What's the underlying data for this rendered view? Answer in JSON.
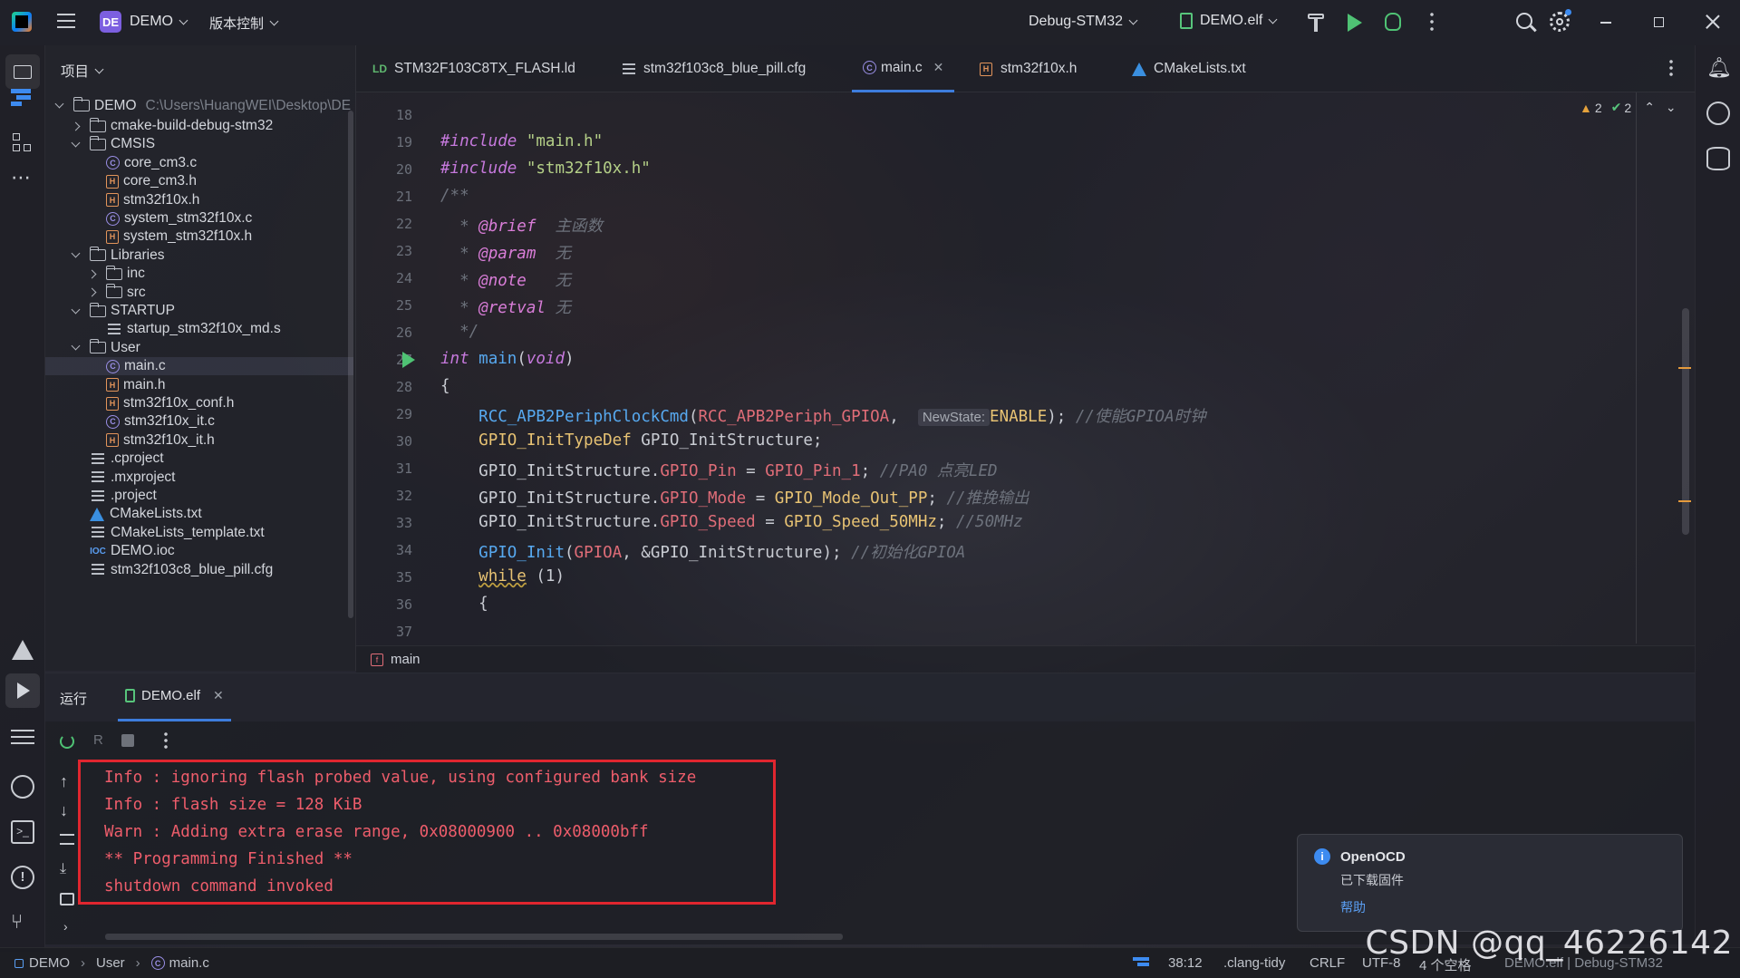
{
  "titlebar": {
    "project_badge": "DE",
    "project_name": "DEMO",
    "vcs": "版本控制",
    "build_config": "Debug-STM32",
    "run_target": "DEMO.elf"
  },
  "project_panel": {
    "title": "项目",
    "root": {
      "name": "DEMO",
      "path": "C:\\Users\\HuangWEI\\Desktop\\DE"
    },
    "items": [
      {
        "label": "cmake-build-debug-stm32",
        "type": "folder",
        "expanded": false,
        "depth": 1
      },
      {
        "label": "CMSIS",
        "type": "folder",
        "expanded": true,
        "depth": 1
      },
      {
        "label": "core_cm3.c",
        "type": "c",
        "depth": 2
      },
      {
        "label": "core_cm3.h",
        "type": "h",
        "depth": 2
      },
      {
        "label": "stm32f10x.h",
        "type": "h",
        "depth": 2
      },
      {
        "label": "system_stm32f10x.c",
        "type": "c",
        "depth": 2
      },
      {
        "label": "system_stm32f10x.h",
        "type": "h",
        "depth": 2
      },
      {
        "label": "Libraries",
        "type": "folder",
        "expanded": true,
        "depth": 1
      },
      {
        "label": "inc",
        "type": "folder",
        "expanded": false,
        "depth": 2
      },
      {
        "label": "src",
        "type": "folder",
        "expanded": false,
        "depth": 2
      },
      {
        "label": "STARTUP",
        "type": "folder",
        "expanded": true,
        "depth": 1
      },
      {
        "label": "startup_stm32f10x_md.s",
        "type": "txt",
        "depth": 2
      },
      {
        "label": "User",
        "type": "folder",
        "expanded": true,
        "depth": 1
      },
      {
        "label": "main.c",
        "type": "c",
        "depth": 2,
        "selected": true
      },
      {
        "label": "main.h",
        "type": "h",
        "depth": 2
      },
      {
        "label": "stm32f10x_conf.h",
        "type": "h",
        "depth": 2
      },
      {
        "label": "stm32f10x_it.c",
        "type": "c",
        "depth": 2
      },
      {
        "label": "stm32f10x_it.h",
        "type": "h",
        "depth": 2
      },
      {
        "label": ".cproject",
        "type": "txt",
        "depth": 1
      },
      {
        "label": ".mxproject",
        "type": "txt",
        "depth": 1
      },
      {
        "label": ".project",
        "type": "txt",
        "depth": 1
      },
      {
        "label": "CMakeLists.txt",
        "type": "cmake",
        "depth": 1
      },
      {
        "label": "CMakeLists_template.txt",
        "type": "txt",
        "depth": 1
      },
      {
        "label": "DEMO.ioc",
        "type": "ioc",
        "depth": 1
      },
      {
        "label": "stm32f103c8_blue_pill.cfg",
        "type": "txt",
        "depth": 1
      }
    ]
  },
  "tabs": [
    {
      "label": "STM32F103C8TX_FLASH.ld",
      "icon": "ld-icon"
    },
    {
      "label": "stm32f103c8_blue_pill.cfg",
      "icon": "config-file-icon"
    },
    {
      "label": "main.c",
      "icon": "c-file-icon",
      "active": true
    },
    {
      "label": "stm32f10x.h",
      "icon": "h-file-icon"
    },
    {
      "label": "CMakeLists.txt",
      "icon": "cmake-icon"
    }
  ],
  "inspections": {
    "warnings": "2",
    "ok": "2"
  },
  "editor": {
    "line_numbers": [
      "18",
      "19",
      "20",
      "21",
      "22",
      "23",
      "24",
      "25",
      "26",
      "27",
      "28",
      "29",
      "30",
      "31",
      "32",
      "33",
      "34",
      "35",
      "36",
      "37"
    ],
    "code": {
      "l19_kw": "#include",
      "l19_str": "\"main.h\"",
      "l20_kw": "#include",
      "l20_str": "\"stm32f10x.h\"",
      "l21": "/**",
      "l22_tag": "@brief",
      "l22_txt": "主函数",
      "l23_tag": "@param",
      "l23_txt": "无",
      "l24_tag": "@note",
      "l24_txt": "无",
      "l25_tag": "@retval",
      "l25_txt": "无",
      "l26": "*/",
      "l27_type": "int",
      "l27_fn": "main",
      "l27_arg": "void",
      "l28": "{",
      "l29_fn": "RCC_APB2PeriphClockCmd",
      "l29_arg": "RCC_APB2Periph_GPIOA",
      "l29_hint": "NewState:",
      "l29_val": "ENABLE",
      "l29_cm": "//使能GPIOA时钟",
      "l30_type": "GPIO_InitTypeDef",
      "l30_var": "GPIO_InitStructure;",
      "l31_var": "GPIO_InitStructure.",
      "l31_field": "GPIO_Pin",
      "l31_val": "GPIO_Pin_1",
      "l31_cm": "//PA0 点亮LED",
      "l32_var": "GPIO_InitStructure.",
      "l32_field": "GPIO_Mode",
      "l32_val": "GPIO_Mode_Out_PP",
      "l32_cm": "//推挽输出",
      "l33_var": "GPIO_InitStructure.",
      "l33_field": "GPIO_Speed",
      "l33_val": "GPIO_Speed_50MHz",
      "l33_cm": "//50MHz",
      "l34_fn": "GPIO_Init",
      "l34_arg": "GPIOA",
      "l34_rest": ", &GPIO_InitStructure);",
      "l34_cm": "//初始化GPIOA",
      "l35_kw": "while",
      "l35_rest": " (1)",
      "l36": "{"
    },
    "breadcrumb": "main"
  },
  "run_panel": {
    "label": "运行",
    "tab": "DEMO.elf",
    "console_lines": [
      "Info : ignoring flash probed value, using configured bank size",
      "Info : flash size = 128 KiB",
      "Warn : Adding extra erase range, 0x08000900 .. 0x08000bff",
      "** Programming Finished **",
      "shutdown command invoked"
    ]
  },
  "notification": {
    "title": "OpenOCD",
    "message": "已下载固件",
    "link": "帮助"
  },
  "statusbar": {
    "crumbs": [
      "DEMO",
      "User",
      "main.c"
    ],
    "position": "38:12",
    "linter": ".clang-tidy",
    "line_ending": "CRLF",
    "encoding": "UTF-8",
    "indent": "4 个空格",
    "context": "DEMO.elf | Debug-STM32"
  },
  "watermark": "CSDN @qq_46226142",
  "colors": {
    "accent": "#3d7cdc",
    "error_box": "#e0262f",
    "console_text": "#ee5d6b"
  }
}
